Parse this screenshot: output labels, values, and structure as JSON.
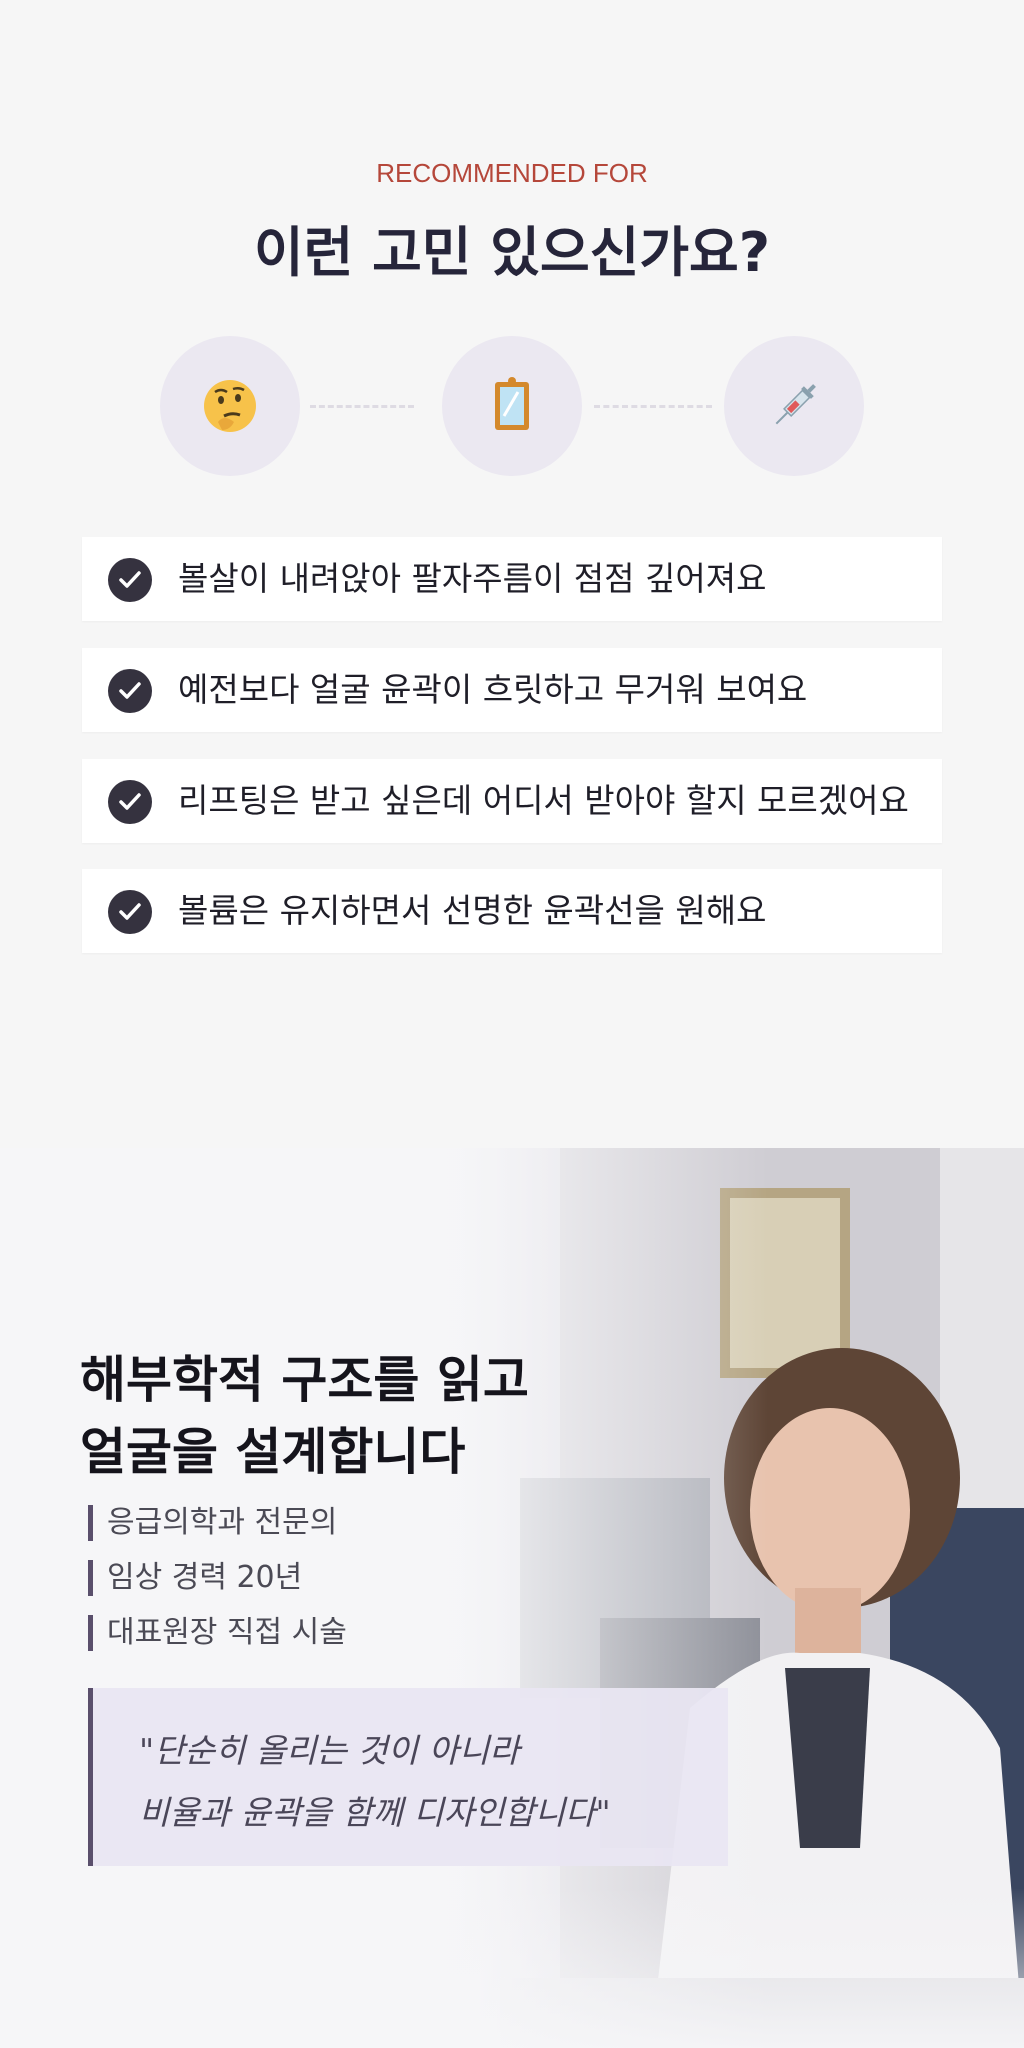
{
  "header": {
    "eyebrow": "RECOMMENDED FOR",
    "title": "이런 고민 있으신가요?"
  },
  "steps": [
    {
      "icon": "thinking-face-icon"
    },
    {
      "icon": "mirror-icon"
    },
    {
      "icon": "syringe-icon"
    }
  ],
  "concerns": [
    "볼살이 내려앉아 팔자주름이 점점 깊어져요",
    "예전보다 얼굴 윤곽이 흐릿하고 무거워 보여요",
    "리프팅은 받고 싶은데 어디서 받아야 할지 모르겠어요",
    "볼륨은 유지하면서 선명한 윤곽선을 원해요"
  ],
  "doctor": {
    "title_line1": "해부학적 구조를 읽고",
    "title_line2": "얼굴을 설계합니다",
    "credentials": [
      "응급의학과 전문의",
      "임상 경력 20년",
      "대표원장 직접 시술"
    ],
    "quote_line1": "\"단순히 올리는 것이 아니라",
    "quote_line2": "비율과 윤곽을 함께 디자인합니다\""
  },
  "colors": {
    "accent": "#b5473a",
    "check": "#35323f",
    "icon_bg": "#ebe8f1",
    "quote_bar": "#5a4f6c"
  }
}
